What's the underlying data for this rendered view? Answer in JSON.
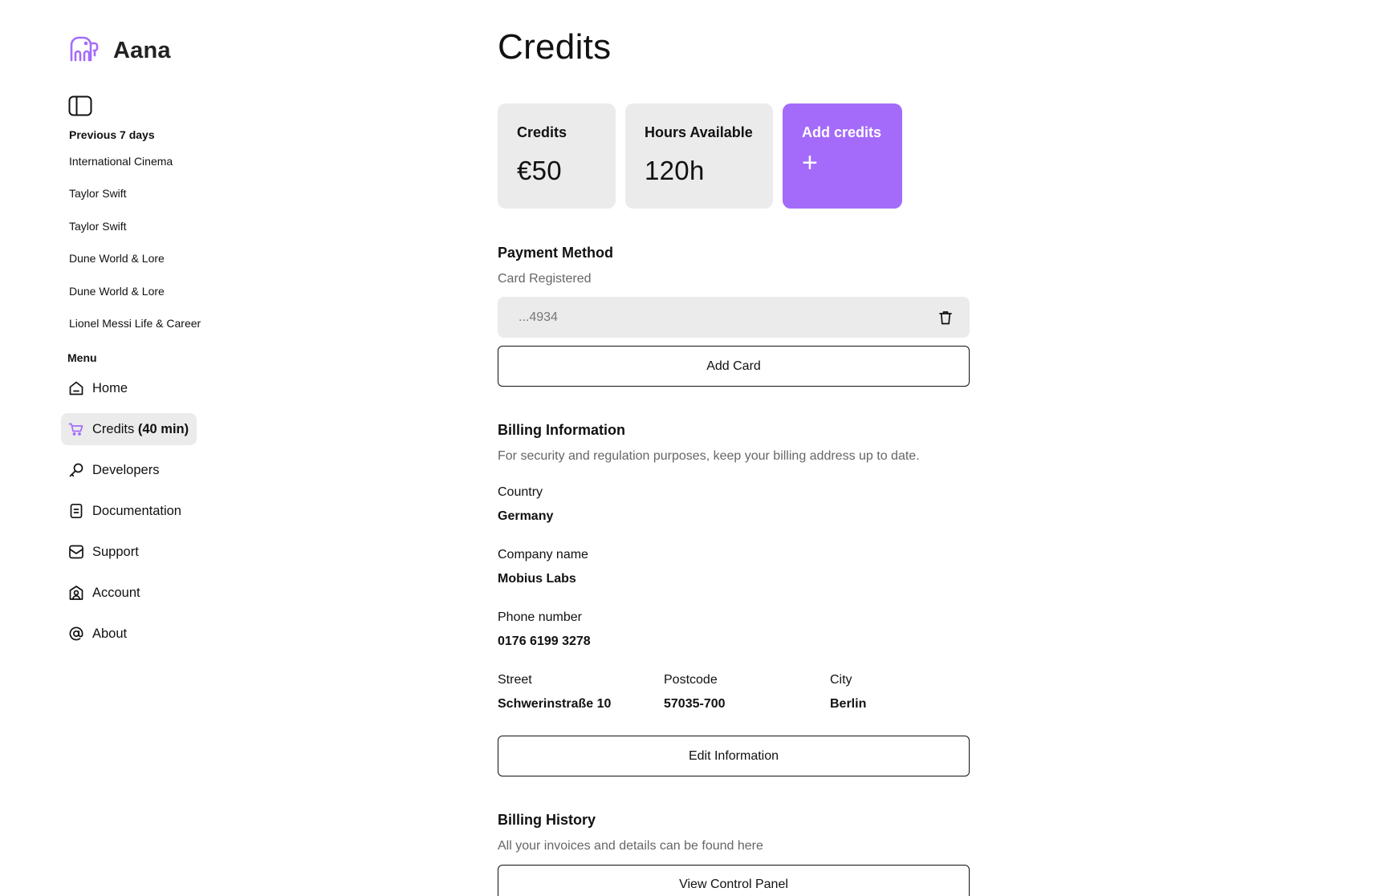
{
  "brand": {
    "name": "Aana",
    "accent": "#a46bfa"
  },
  "sidebar": {
    "history_title": "Previous 7 days",
    "history": [
      "International Cinema",
      "Taylor Swift",
      "Taylor Swift",
      "Dune World & Lore",
      "Dune World & Lore",
      "Lionel Messi Life & Career"
    ],
    "menu_title": "Menu",
    "menu": [
      {
        "label": "Home",
        "icon": "home-icon"
      },
      {
        "label": "Credits",
        "suffix": "(40 min)",
        "icon": "cart-icon",
        "active": true
      },
      {
        "label": "Developers",
        "icon": "key-icon"
      },
      {
        "label": "Documentation",
        "icon": "document-icon"
      },
      {
        "label": "Support",
        "icon": "mail-icon"
      },
      {
        "label": "Account",
        "icon": "account-icon"
      },
      {
        "label": "About",
        "icon": "at-icon"
      }
    ]
  },
  "page": {
    "title": "Credits"
  },
  "stats": {
    "credits_label": "Credits",
    "credits_value": "€50",
    "hours_label": "Hours Available",
    "hours_value": "120h",
    "add_label": "Add credits",
    "add_symbol": "+"
  },
  "payment": {
    "title": "Payment Method",
    "subtitle": "Card Registered",
    "card_number": "...4934",
    "add_card_label": "Add Card"
  },
  "billing": {
    "title": "Billing Information",
    "subtitle": "For security and regulation purposes, keep your billing address up to date.",
    "country_label": "Country",
    "country_value": "Germany",
    "company_label": "Company name",
    "company_value": "Mobius Labs",
    "phone_label": "Phone number",
    "phone_value": "0176 6199 3278",
    "street_label": "Street",
    "street_value": "Schwerinstraße 10",
    "postcode_label": "Postcode",
    "postcode_value": "57035-700",
    "city_label": "City",
    "city_value": "Berlin",
    "edit_label": "Edit Information"
  },
  "history": {
    "title": "Billing History",
    "subtitle": "All your invoices and details can be found here",
    "button_label": "View Control Panel"
  }
}
